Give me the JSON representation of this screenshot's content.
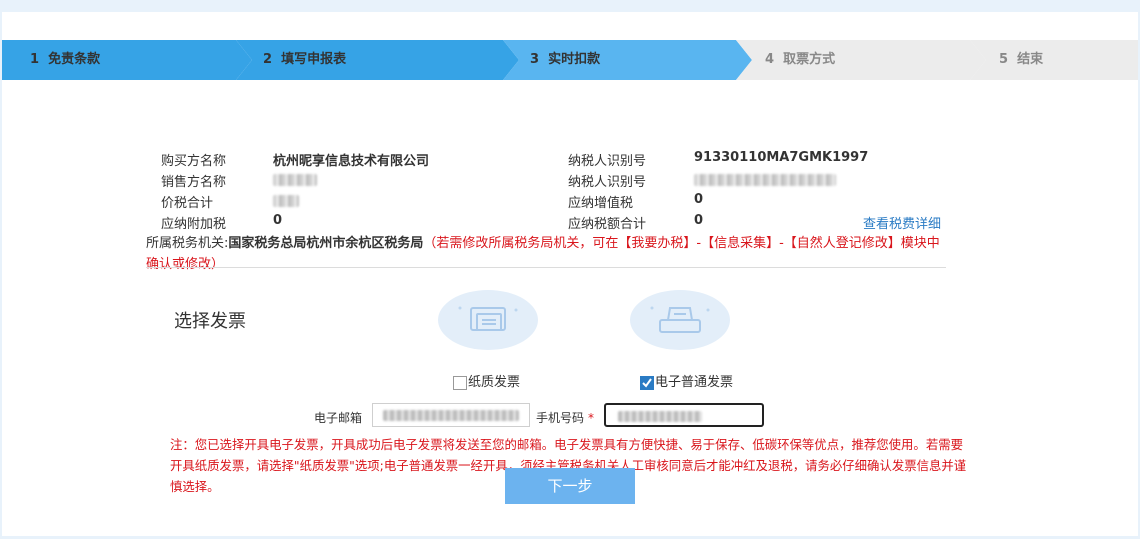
{
  "steps": [
    {
      "num": "1",
      "label": "免责条款",
      "state": "done"
    },
    {
      "num": "2",
      "label": "填写申报表",
      "state": "done"
    },
    {
      "num": "3",
      "label": "实时扣款",
      "state": "active"
    },
    {
      "num": "4",
      "label": "取票方式",
      "state": "pending"
    },
    {
      "num": "5",
      "label": "结束",
      "state": "pending"
    }
  ],
  "info": {
    "buyer_name_label": "购买方名称",
    "buyer_name": "杭州昵享信息技术有限公司",
    "buyer_tax_id_label": "纳税人识别号",
    "buyer_tax_id": "91330110MA7GMK1997",
    "seller_name_label": "销售方名称",
    "seller_tax_id_label": "纳税人识别号",
    "total_label": "价税合计",
    "vat_label": "应纳增值税",
    "vat_value": "0",
    "surcharge_label": "应纳附加税",
    "surcharge_value": "0",
    "tax_total_label": "应纳税额合计",
    "tax_total_value": "0",
    "detail_link": "查看税费详细"
  },
  "tax_office": {
    "label": "所属税务机关:",
    "name": "国家税务总局杭州市余杭区税务局",
    "note": "（若需修改所属税务局机关，可在【我要办税】-【信息采集】-【自然人登记修改】模块中确认或修改）"
  },
  "invoice": {
    "title": "选择发票",
    "paper_label": "纸质发票",
    "electronic_label": "电子普通发票",
    "paper_checked": false,
    "electronic_checked": true
  },
  "form": {
    "email_label": "电子邮箱",
    "phone_label": "手机号码",
    "required_mark": "*"
  },
  "notice": "注：您已选择开具电子发票，开具成功后电子发票将发送至您的邮箱。电子发票具有方便快捷、易于保存、低碳环保等优点，推荐您使用。若需要开具纸质发票，请选择\"纸质发票\"选项;电子普通发票一经开具，须经主管税务机关人工审核同意后才能冲红及退税，请务必仔细确认发票信息并谨慎选择。",
  "next_button": "下一步",
  "colors": {
    "step_done": "#36a3e6",
    "step_active": "#59b5f0",
    "step_pending": "#ececec",
    "accent": "#2a7bc4",
    "warning": "#d9161c"
  }
}
